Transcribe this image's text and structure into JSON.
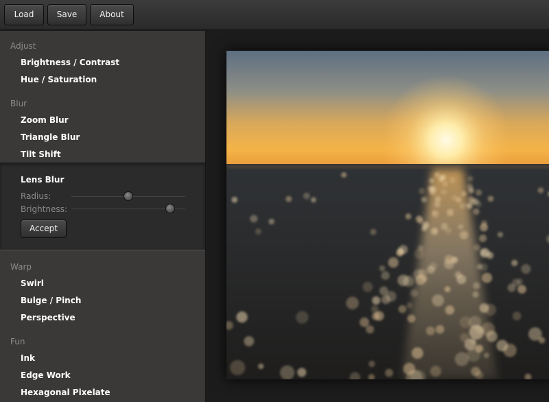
{
  "toolbar": {
    "load_label": "Load",
    "save_label": "Save",
    "about_label": "About"
  },
  "sidebar": {
    "adjust": {
      "label": "Adjust",
      "items": [
        "Brightness / Contrast",
        "Hue / Saturation"
      ]
    },
    "blur": {
      "label": "Blur",
      "items": [
        "Zoom Blur",
        "Triangle Blur",
        "Tilt Shift"
      ]
    },
    "active_filter": {
      "title": "Lens Blur",
      "sliders": [
        {
          "label": "Radius:",
          "value": 0.5
        },
        {
          "label": "Brightness:",
          "value": 0.87
        }
      ],
      "accept_label": "Accept"
    },
    "warp": {
      "label": "Warp",
      "items": [
        "Swirl",
        "Bulge / Pinch",
        "Perspective"
      ]
    },
    "fun": {
      "label": "Fun",
      "items": [
        "Ink",
        "Edge Work",
        "Hexagonal Pixelate"
      ]
    }
  },
  "colors": {
    "sidebar_bg": "#3a3938",
    "panel_bg": "#2b2b2b",
    "stage_bg": "#1c1c1c",
    "section_label": "#8c8c8c"
  }
}
